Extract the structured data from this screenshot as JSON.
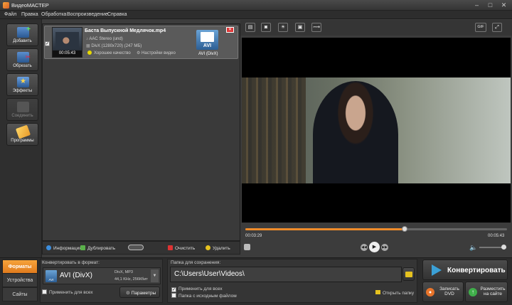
{
  "window": {
    "title": "ВидеоМАСТЕР"
  },
  "menu": [
    "Файл",
    "Правка",
    "Обработка",
    "Воспроизведение",
    "Справка"
  ],
  "left_toolbar": [
    {
      "label": "Добавить",
      "icon": "add-film-icon",
      "enabled": true
    },
    {
      "label": "Обрезать",
      "icon": "cut-film-icon",
      "enabled": true
    },
    {
      "label": "Эффекты",
      "icon": "effects-icon",
      "enabled": true
    },
    {
      "label": "Соединить",
      "icon": "join-icon",
      "enabled": false
    },
    {
      "label": "Программы",
      "icon": "programs-icon",
      "enabled": true
    }
  ],
  "file": {
    "duration": "00:05:43",
    "name": "Баста    Выпускной Медлячок.mp4",
    "audio": "AAC Stereo (und)",
    "video": "DivX (1280x720) (247 МБ)",
    "quality": "Хорошее качество",
    "settings": "Настройки видео",
    "output_badge": "AVI",
    "output_format": "AVI (DivX)"
  },
  "list_toolbar": {
    "info": "Информация",
    "duplicate": "Дублировать",
    "clear": "Очистить",
    "delete": "Удалить"
  },
  "player": {
    "current_time": "00:03:29",
    "total_time": "00:05:43",
    "progress": 0.61,
    "gif_label": "GIF"
  },
  "bottom": {
    "tabs": [
      {
        "label": "Форматы",
        "active": true
      },
      {
        "label": "Устройства",
        "active": false
      },
      {
        "label": "Сайты",
        "active": false
      }
    ],
    "convert_caption": "Конвертировать в формат:",
    "format_name": "AVI (DivX)",
    "format_badge": "AVI",
    "codecs": "DivX, MP3",
    "audio_params": "44,1 KHz, 256Кбит",
    "apply_all": "Применить для всех",
    "params": "Параметры",
    "save_caption": "Папка для сохранения:",
    "path": "C:\\Users\\User\\Videos\\",
    "apply_all_2": "Применить для всех",
    "same_folder": "Папка с исходным файлом",
    "open_folder": "Открыть папку",
    "convert": "Конвертировать",
    "burn_dvd_1": "Записать",
    "burn_dvd_2": "DVD",
    "publish_1": "Разместить",
    "publish_2": "на сайте"
  },
  "colors": {
    "accent": "#f08c2a",
    "convert_arrow": "#3ba0d6"
  }
}
